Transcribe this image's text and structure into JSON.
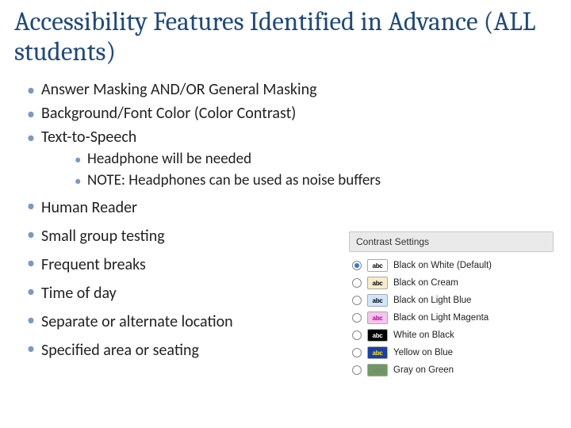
{
  "title": "Accessibility Features Identified in Advance (ALL students)",
  "bullets1": [
    "Answer Masking AND/OR General Masking",
    "Background/Font Color (Color Contrast)",
    "Text-to-Speech"
  ],
  "sub_bullets": [
    "Headphone will be needed",
    "NOTE:  Headphones can be used as noise buffers"
  ],
  "bullets2": [
    "Human Reader",
    "Small group testing",
    "Frequent breaks",
    "Time of day",
    "Separate or alternate location",
    "Specified area or seating"
  ],
  "contrast": {
    "title": "Contrast Settings",
    "abc": "abc",
    "options": [
      {
        "label": "Black on White (Default)",
        "bg": "#ffffff",
        "fg": "#000000",
        "selected": true
      },
      {
        "label": "Black on Cream",
        "bg": "#f8eccb",
        "fg": "#000000",
        "selected": false
      },
      {
        "label": "Black on Light Blue",
        "bg": "#cfe6ff",
        "fg": "#000000",
        "selected": false
      },
      {
        "label": "Black on Light Magenta",
        "bg": "#f3c6ea",
        "fg": "#b400a8",
        "selected": false
      },
      {
        "label": "White on Black",
        "bg": "#000000",
        "fg": "#ffffff",
        "selected": false
      },
      {
        "label": "Yellow on Blue",
        "bg": "#1840a8",
        "fg": "#ffe600",
        "selected": false
      },
      {
        "label": "Gray on Green",
        "bg": "#6e9a5f",
        "fg": "#808080",
        "selected": false
      }
    ]
  }
}
